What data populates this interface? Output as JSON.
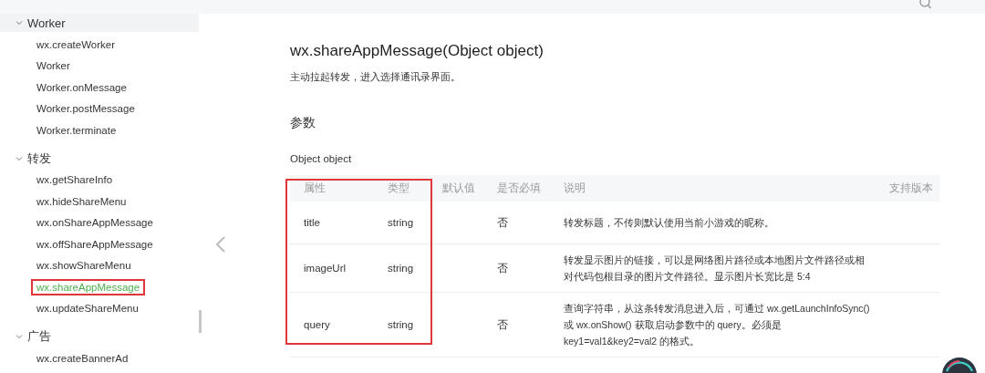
{
  "sidebar": {
    "groups": [
      {
        "label": "Worker",
        "expanded": true,
        "hovered": true,
        "items": [
          {
            "label": "wx.createWorker",
            "selected": false,
            "annotated": false
          },
          {
            "label": "Worker",
            "selected": false,
            "annotated": false
          },
          {
            "label": "Worker.onMessage",
            "selected": false,
            "annotated": false
          },
          {
            "label": "Worker.postMessage",
            "selected": false,
            "annotated": false
          },
          {
            "label": "Worker.terminate",
            "selected": false,
            "annotated": false
          }
        ]
      },
      {
        "label": "转发",
        "expanded": true,
        "hovered": false,
        "items": [
          {
            "label": "wx.getShareInfo",
            "selected": false,
            "annotated": false
          },
          {
            "label": "wx.hideShareMenu",
            "selected": false,
            "annotated": false
          },
          {
            "label": "wx.onShareAppMessage",
            "selected": false,
            "annotated": false
          },
          {
            "label": "wx.offShareAppMessage",
            "selected": false,
            "annotated": false
          },
          {
            "label": "wx.showShareMenu",
            "selected": false,
            "annotated": false
          },
          {
            "label": "wx.shareAppMessage",
            "selected": true,
            "annotated": true
          },
          {
            "label": "wx.updateShareMenu",
            "selected": false,
            "annotated": false
          }
        ]
      },
      {
        "label": "广告",
        "expanded": true,
        "hovered": false,
        "items": [
          {
            "label": "wx.createBannerAd",
            "selected": false,
            "annotated": false
          }
        ]
      }
    ]
  },
  "article": {
    "title": "wx.shareAppMessage(Object object)",
    "description": "主动拉起转发，进入选择通讯录界面。",
    "section": "参数",
    "subsection": "Object object",
    "table": {
      "columns": [
        {
          "label": "属性",
          "annotated": true
        },
        {
          "label": "类型",
          "annotated": true
        },
        {
          "label": "默认值",
          "annotated": false
        },
        {
          "label": "是否必填",
          "annotated": false
        },
        {
          "label": "说明",
          "annotated": false
        },
        {
          "label": "支持版本",
          "annotated": false
        }
      ],
      "rows": [
        [
          "title",
          "string",
          "",
          "否",
          "转发标题，不传则默认使用当前小游戏的昵称。",
          ""
        ],
        [
          "imageUrl",
          "string",
          "",
          "否",
          "转发显示图片的链接，可以是网络图片路径或本地图片文件路径或相对代码包根目录的图片文件路径。显示图片长宽比是 5:4",
          ""
        ],
        [
          "query",
          "string",
          "",
          "否",
          "查询字符串，从这条转发消息进入后，可通过 wx.getLaunchInfoSync() 或 wx.onShow() 获取启动参数中的 query。必须是 key1=val1&key2=val2 的格式。",
          ""
        ]
      ]
    }
  }
}
